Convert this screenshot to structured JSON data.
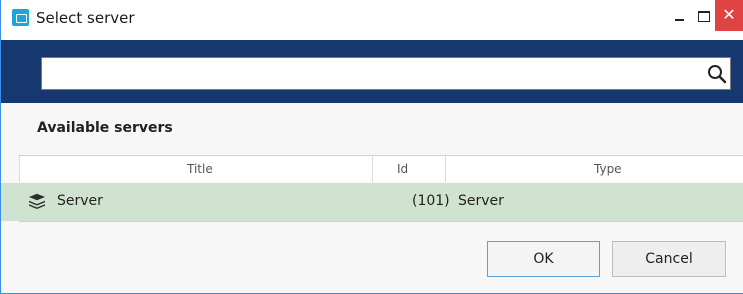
{
  "window": {
    "title": "Select server",
    "close_glyph": "✕",
    "icons": {
      "app": "app-icon",
      "minimize": "minimize-icon",
      "maximize": "maximize-icon",
      "close": "close-icon"
    }
  },
  "search": {
    "value": "",
    "placeholder": "",
    "icon": "search-icon"
  },
  "section": {
    "title": "Available servers"
  },
  "table": {
    "columns": [
      "Title",
      "Id",
      "Type"
    ],
    "rows": [
      {
        "icon": "server-stack-icon",
        "title": "Server",
        "id": "(101)",
        "type": "Server"
      }
    ]
  },
  "buttons": {
    "ok": "OK",
    "cancel": "Cancel"
  },
  "colors": {
    "header_band": "#17386e",
    "selected_row": "#cfe3d0",
    "close_button": "#e04343",
    "accent_border": "#3a8ee6"
  }
}
